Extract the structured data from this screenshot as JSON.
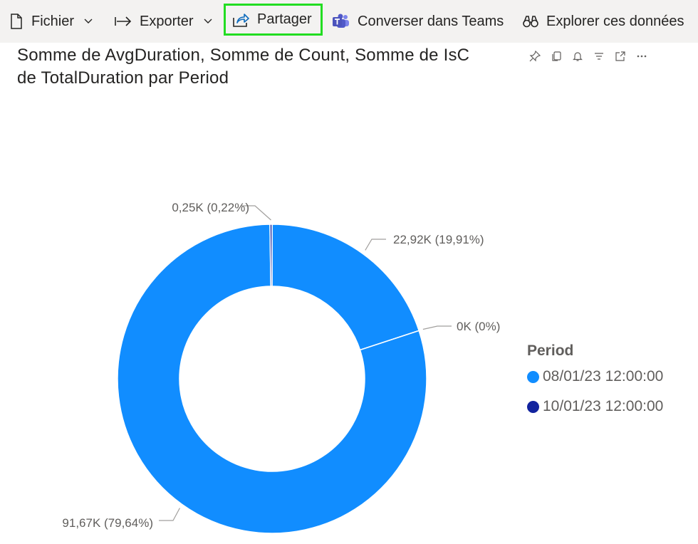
{
  "toolbar": {
    "file_label": "Fichier",
    "export_label": "Exporter",
    "share_label": "Partager",
    "teams_label": "Converser dans Teams",
    "explore_label": "Explorer ces données"
  },
  "visual_header": {
    "icons": [
      "pin-icon",
      "copy-icon",
      "bell-icon",
      "filter-icon",
      "focus-mode-icon",
      "more-options-icon"
    ]
  },
  "colors": {
    "series_1": "#118dff",
    "series_2": "#12239e",
    "highlight_border": "#22dd22"
  },
  "chart_data": {
    "type": "pie",
    "variant": "donut",
    "title_line1": "Somme de AvgDuration, Somme de Count, Somme de IsC",
    "title_line2": "de TotalDuration par Period",
    "legend_title": "Period",
    "legend_placement": "right",
    "slices": [
      {
        "label": "22,92K (19,91%)",
        "value": 22.92,
        "percent": 19.91,
        "period": "08/01/23 12:00:00"
      },
      {
        "label": "0K (0%)",
        "value": 0,
        "percent": 0,
        "period": "08/01/23 12:00:00"
      },
      {
        "label": "91,67K (79,64%)",
        "value": 91.67,
        "percent": 79.64,
        "period": "08/01/23 12:00:00"
      },
      {
        "label": "0,25K (0,22%)",
        "value": 0.25,
        "percent": 0.22,
        "period": "10/01/23 12:00:00"
      }
    ],
    "legend": [
      {
        "name": "08/01/23 12:00:00",
        "color": "#118dff"
      },
      {
        "name": "10/01/23 12:00:00",
        "color": "#12239e"
      }
    ]
  }
}
